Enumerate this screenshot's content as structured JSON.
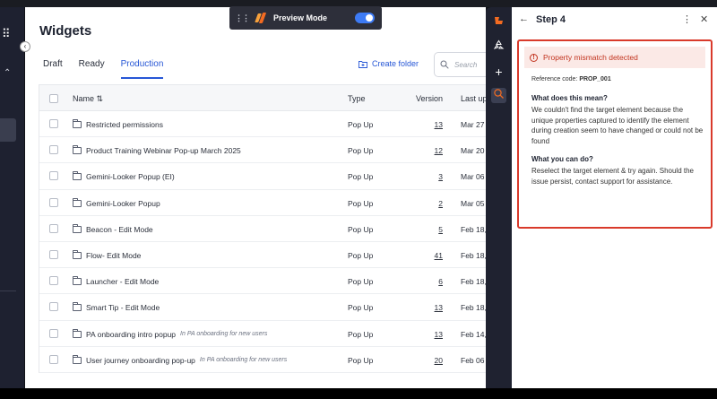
{
  "nav": {
    "apps_icon": "grid-icon",
    "switcher_icon": "chevron-updown-icon"
  },
  "preview": {
    "label": "Preview Mode",
    "toggle_on": true
  },
  "page": {
    "title": "Widgets"
  },
  "tabs": [
    {
      "label": "Draft"
    },
    {
      "label": "Ready"
    },
    {
      "label": "Production",
      "active": true
    }
  ],
  "toolbar": {
    "create_folder": "Create folder",
    "search_placeholder": "Search"
  },
  "table": {
    "headers": {
      "name": "Name ⇅",
      "type": "Type",
      "version": "Version",
      "last": "Last up"
    },
    "rows": [
      {
        "name": "Restricted permissions",
        "sub": "",
        "type": "Pop Up",
        "version": "13",
        "last": "Mar 27"
      },
      {
        "name": "Product Training Webinar Pop-up March 2025",
        "sub": "",
        "type": "Pop Up",
        "version": "12",
        "last": "Mar 20"
      },
      {
        "name": "Gemini-Looker Popup (EI)",
        "sub": "",
        "type": "Pop Up",
        "version": "3",
        "last": "Mar 06"
      },
      {
        "name": "Gemini-Looker Popup",
        "sub": "",
        "type": "Pop Up",
        "version": "2",
        "last": "Mar 05"
      },
      {
        "name": "Beacon - Edit Mode",
        "sub": "",
        "type": "Pop Up",
        "version": "5",
        "last": "Feb 18,"
      },
      {
        "name": "Flow- Edit Mode",
        "sub": "",
        "type": "Pop Up",
        "version": "41",
        "last": "Feb 18,"
      },
      {
        "name": "Launcher - Edit Mode",
        "sub": "",
        "type": "Pop Up",
        "version": "6",
        "last": "Feb 18,"
      },
      {
        "name": "Smart Tip - Edit Mode",
        "sub": "",
        "type": "Pop Up",
        "version": "13",
        "last": "Feb 18,"
      },
      {
        "name": "PA onboarding intro popup",
        "sub": "In PA onboarding for new users",
        "type": "Pop Up",
        "version": "13",
        "last": "Feb 14,"
      },
      {
        "name": "User journey onboarding pop-up",
        "sub": "In PA onboarding for new users",
        "type": "Pop Up",
        "version": "20",
        "last": "Feb 06"
      }
    ]
  },
  "rail": {
    "icons": [
      "brand-logo-icon",
      "recycle-icon",
      "plus-icon",
      "search-debug-icon"
    ]
  },
  "panel": {
    "title": "Step 4",
    "error_title": "Property mismatch detected",
    "ref_label": "Reference code: ",
    "ref_code": "PROP_001",
    "q1": "What does this mean?",
    "a1": "We couldn't find the target element because the unique properties captured to identify the element during creation seem to have changed or could not be found",
    "q2": "What you can do?",
    "a2": "Reselect the target element & try again. Should the issue persist, contact support for assistance."
  }
}
